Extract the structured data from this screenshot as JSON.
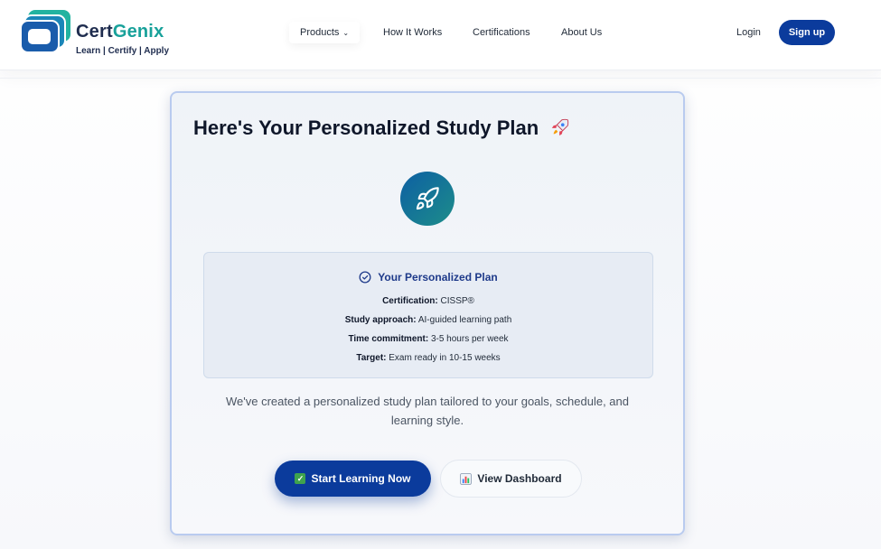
{
  "brand": {
    "name_part1": "Cert",
    "name_part2": "Genix",
    "tagline": "Learn | Certify | Apply",
    "colors": {
      "navy": "#1f2d4f",
      "teal": "#18a19a",
      "primary": "#0b3b9c"
    }
  },
  "nav": {
    "items": [
      {
        "label": "Products",
        "has_dropdown": true
      },
      {
        "label": "How It Works"
      },
      {
        "label": "Certifications"
      },
      {
        "label": "About Us"
      }
    ],
    "login_label": "Login",
    "signup_label": "Sign up"
  },
  "card": {
    "title": "Here's Your Personalized Study Plan",
    "title_icon": "rocket-icon",
    "hero_icon": "rocket-icon",
    "plan": {
      "heading": "Your Personalized Plan",
      "heading_icon": "check-circle-icon",
      "rows": [
        {
          "label": "Certification:",
          "value": "CISSP®"
        },
        {
          "label": "Study approach:",
          "value": "AI-guided learning path"
        },
        {
          "label": "Time commitment:",
          "value": "3-5 hours per week"
        },
        {
          "label": "Target:",
          "value": "Exam ready in 10-15 weeks"
        }
      ]
    },
    "description": "We've created a personalized study plan tailored to your goals, schedule, and learning style.",
    "buttons": {
      "start": {
        "label": "Start Learning Now",
        "icon": "check-box-icon"
      },
      "dashboard": {
        "label": "View Dashboard",
        "icon": "bar-chart-icon"
      }
    }
  }
}
